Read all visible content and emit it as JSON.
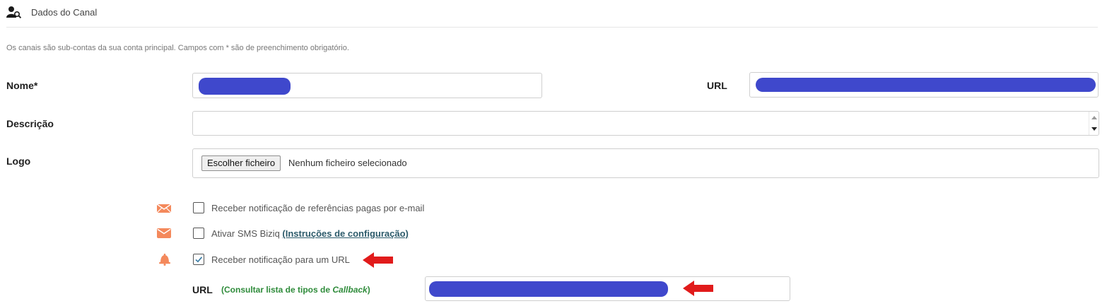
{
  "header": {
    "title": "Dados do Canal",
    "icon": "user-search-icon"
  },
  "intro": "Os canais são sub-contas da sua conta principal. Campos com *  são de preenchimento obrigatório.",
  "form": {
    "nome_label": "Nome*",
    "url_label": "URL",
    "descricao_label": "Descrição",
    "logo_label": "Logo",
    "file_button": "Escolher ficheiro",
    "file_status": "Nenhum ficheiro selecionado"
  },
  "options": [
    {
      "icon": "envelope-open-icon",
      "label": "Receber notificação de referências pagas por e-mail",
      "checked": false
    },
    {
      "icon": "envelope-icon",
      "label": "Ativar SMS Biziq ",
      "link": "(Instruções de configuração)",
      "checked": false
    },
    {
      "icon": "bell-icon",
      "label": "Receber notificação para um URL",
      "checked": true
    }
  ],
  "callback": {
    "label": "URL",
    "hint_prefix": "(Consultar lista de tipos de ",
    "hint_italic": "Callback",
    "hint_suffix": ")"
  },
  "colors": {
    "accent_orange": "#f4895c",
    "redaction": "#3f48cc",
    "arrow_red": "#e11b1b",
    "hint_green": "#2e8b3a"
  }
}
